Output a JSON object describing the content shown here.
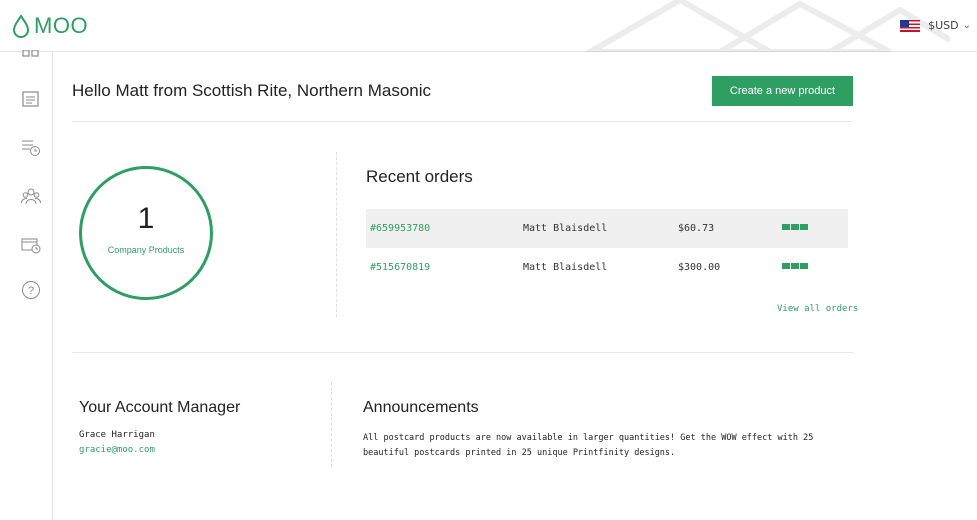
{
  "brand": {
    "name": "MOO",
    "accent": "#2e9e62"
  },
  "header": {
    "currency": "$USD",
    "flag": "us-flag-icon"
  },
  "sidebar": {
    "items": [
      {
        "icon": "grid-icon"
      },
      {
        "icon": "products-icon"
      },
      {
        "icon": "orders-history-icon"
      },
      {
        "icon": "users-icon"
      },
      {
        "icon": "billing-icon"
      },
      {
        "icon": "help-icon"
      }
    ]
  },
  "main": {
    "greeting": "Hello Matt from Scottish Rite, Northern Masonic",
    "create_button": "Create a new product",
    "products": {
      "count": "1",
      "label": "Company Products"
    },
    "recent_orders": {
      "title": "Recent orders",
      "rows": [
        {
          "id": "#659953780",
          "name": "Matt Blaisdell",
          "price": "$60.73"
        },
        {
          "id": "#515670819",
          "name": "Matt Blaisdell",
          "price": "$300.00"
        }
      ],
      "view_all": "View all orders"
    },
    "account_manager": {
      "title": "Your Account Manager",
      "name": "Grace Harrigan",
      "email": "gracie@moo.com"
    },
    "announcements": {
      "title": "Announcements",
      "text": "All postcard products are now available in larger quantities! Get the WOW effect with 25 beautiful postcards printed in 25 unique Printfinity designs."
    }
  }
}
